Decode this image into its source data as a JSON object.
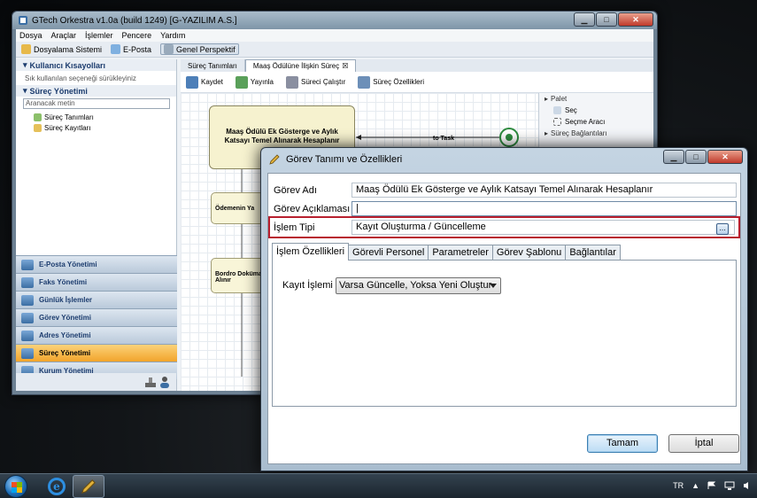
{
  "main_window": {
    "title": "GTech Orkestra v1.0a (build 1249) [G-YAZILIM A.S.]",
    "menu": [
      "Dosya",
      "Araçlar",
      "İşlemler",
      "Pencere",
      "Yardım"
    ],
    "toolbar": [
      "Dosyalama Sistemi",
      "E-Posta",
      "Genel Perspektif"
    ]
  },
  "left_pane": {
    "shortcuts_title": "Kullanıcı Kısayolları",
    "shortcuts_hint": "Sık kullanılan seçeneği sürükleyiniz",
    "process_title": "Süreç Yönetimi",
    "search_placeholder": "Aranacak metin",
    "tree": [
      "Süreç Tanımları",
      "Süreç Kayıtları"
    ],
    "nav": [
      "E-Posta Yönetimi",
      "Faks Yönetimi",
      "Günlük İşlemler",
      "Görev Yönetimi",
      "Adres Yönetimi",
      "Süreç Yönetimi",
      "Kurum Yönetimi"
    ],
    "nav_active_index": 5
  },
  "editor": {
    "tabs": [
      "Süreç Tanımları",
      "Maaş Ödülüne İlişkin Süreç"
    ],
    "toolbar": [
      "Kaydet",
      "Yayınla",
      "Süreci Çalıştır",
      "Süreç Özellikleri"
    ],
    "task_main": "Maaş Ödülü Ek Gösterge ve Aylık Katsayı Temel Alınarak Hesaplanır",
    "task_2": "Ödemenin Ya",
    "task_3": "Bordro Dokümanı Alınır",
    "edge_label": "to Task",
    "palette": {
      "title": "Palet",
      "items": [
        "Seç",
        "Seçme Aracı"
      ],
      "group": "Süreç Bağlantıları"
    }
  },
  "dialog": {
    "title": "Görev Tanımı ve Özellikleri",
    "fields": {
      "name_label": "Görev Adı",
      "name_value": "Maaş Ödülü Ek Gösterge ve Aylık Katsayı Temel Alınarak Hesaplanır",
      "desc_label": "Görev Açıklaması",
      "desc_value": "",
      "type_label": "İşlem Tipi",
      "type_value": "Kayıt Oluşturma / Güncelleme",
      "type_button": "..."
    },
    "tabs": [
      "İşlem Özellikleri",
      "Görevli Personel",
      "Parametreler",
      "Görev Şablonu",
      "Bağlantılar"
    ],
    "active_tab": 0,
    "record_label": "Kayıt İşlemi",
    "record_value": "Varsa Güncelle, Yoksa Yeni Oluştur",
    "ok": "Tamam",
    "cancel": "İptal"
  },
  "taskbar": {
    "language": "TR",
    "tray_arrow": "▲"
  }
}
